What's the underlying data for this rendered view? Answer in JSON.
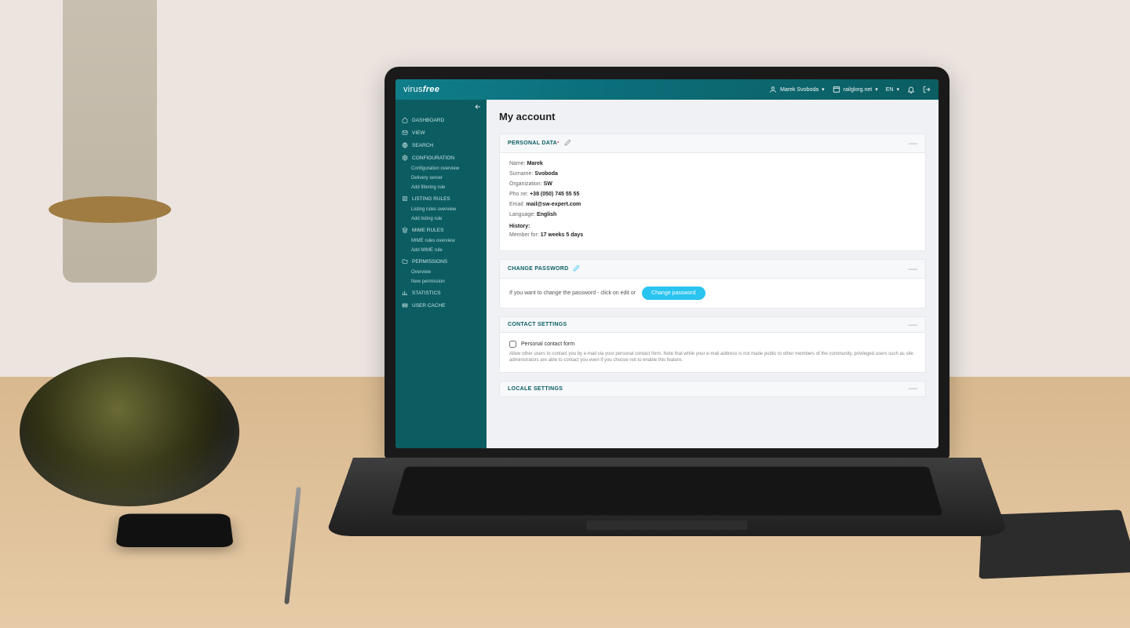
{
  "brand": {
    "part1": "virus",
    "part2": "free"
  },
  "topbar": {
    "user": "Marek Svoboda",
    "domain": "railglorg.net",
    "lang": "EN"
  },
  "sidebar": {
    "dashboard": "DASHBOARD",
    "view": "VIEW",
    "search": "SEARCH",
    "configuration": "CONFIGURATION",
    "conf_overview": "Configuration overview",
    "delivery_server": "Delivery server",
    "add_filtering_rule": "Add filtering rule",
    "listing_rules": "LISTING RULES",
    "listing_rules_overview": "Listing rules overview",
    "add_listing_rule": "Add listing rule",
    "mime_rules": "MIME RULES",
    "mime_rules_overview": "MIME rules overview",
    "add_mime_rule": "Add MIME rule",
    "permissions": "PERMISSIONS",
    "perm_overview": "Overview",
    "new_permission": "New permission",
    "statistics": "STATISTICS",
    "user_cache": "USER CACHE"
  },
  "page": {
    "title": "My account"
  },
  "personal": {
    "heading": "PERSONAL DATA",
    "name_label": "Name:",
    "name_value": "Marek",
    "surname_label": "Surname:",
    "surname_value": "Svoboda",
    "org_label": "Organization:",
    "org_value": "SW",
    "phone_label": "Pho ne:",
    "phone_value": "+38 (050) 745 55 55",
    "email_label": "Email:",
    "email_value": "mail@sw-expert.com",
    "lang_label": "Language:",
    "lang_value": "English",
    "history_heading": "History:",
    "member_label": "Member for:",
    "member_value": "17 weeks 5 days"
  },
  "password": {
    "heading": "CHANGE PASSWORD",
    "text": "If you want to change the password - click on edit or",
    "button": "Change password"
  },
  "contact": {
    "heading": "CONTACT SETTINGS",
    "checkbox_label": "Personal contact form",
    "note": "Allow other users to contact you by e-mail via your personal contact form. Note that while your e-mail address is not made public to other members of the community, privileged users such as site administrators are able to contact you even if you choose not to enable this feature."
  },
  "locale": {
    "heading": "LOCALE SETTINGS"
  }
}
